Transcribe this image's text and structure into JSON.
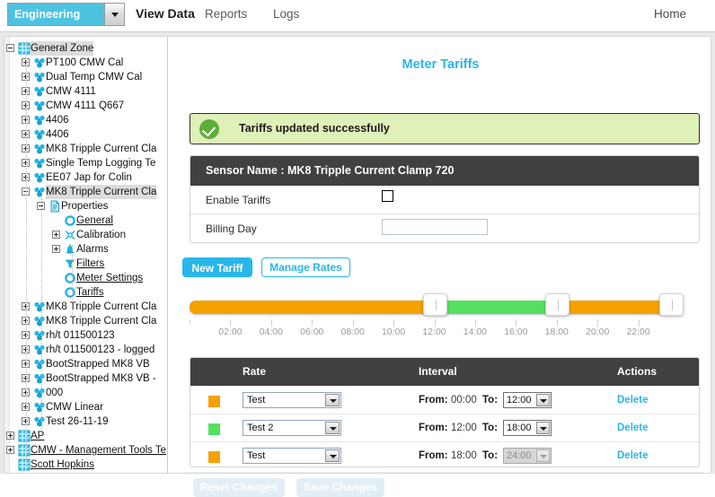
{
  "topnav": {
    "zone_selector": {
      "value": "Engineering",
      "icon": "chevron-down-icon"
    },
    "items": [
      {
        "label": "View Data",
        "active": true
      },
      {
        "label": "Reports",
        "active": false
      },
      {
        "label": "Logs",
        "active": false
      }
    ],
    "home_label": "Home"
  },
  "sidebar": {
    "nodes": [
      {
        "label": "General Zone",
        "depth": 0,
        "icon": "zone-grid-icon",
        "toggle": "minus",
        "selected": true,
        "link": false
      },
      {
        "label": "PT100 CMW Cal",
        "depth": 1,
        "icon": "sensor-icon",
        "toggle": "plus",
        "selected": false,
        "link": false
      },
      {
        "label": "Dual Temp CMW Cal",
        "depth": 1,
        "icon": "sensor-icon",
        "toggle": "plus",
        "selected": false,
        "link": false
      },
      {
        "label": "CMW 4111",
        "depth": 1,
        "icon": "sensor-icon",
        "toggle": "plus",
        "selected": false,
        "link": false
      },
      {
        "label": "CMW 4111 Q667",
        "depth": 1,
        "icon": "sensor-icon",
        "toggle": "plus",
        "selected": false,
        "link": false
      },
      {
        "label": "4406",
        "depth": 1,
        "icon": "sensor-icon",
        "toggle": "plus",
        "selected": false,
        "link": false
      },
      {
        "label": "4406",
        "depth": 1,
        "icon": "sensor-icon",
        "toggle": "plus",
        "selected": false,
        "link": false
      },
      {
        "label": "MK8 Tripple Current Cla",
        "depth": 1,
        "icon": "sensor-icon",
        "toggle": "plus",
        "selected": false,
        "link": false
      },
      {
        "label": "Single Temp Logging Te",
        "depth": 1,
        "icon": "sensor-icon",
        "toggle": "plus",
        "selected": false,
        "link": false
      },
      {
        "label": "EE07 Jap for Colin",
        "depth": 1,
        "icon": "sensor-icon",
        "toggle": "plus",
        "selected": false,
        "link": false
      },
      {
        "label": "MK8 Tripple Current Cla",
        "depth": 1,
        "icon": "sensor-icon",
        "toggle": "minus",
        "selected": true,
        "link": false
      },
      {
        "label": "Properties",
        "depth": 2,
        "icon": "document-icon",
        "toggle": "minus",
        "selected": false,
        "link": false
      },
      {
        "label": "General",
        "depth": 3,
        "icon": "circle-icon",
        "toggle": "none",
        "selected": false,
        "link": true
      },
      {
        "label": "Calibration",
        "depth": 3,
        "icon": "calibration-icon",
        "toggle": "plus",
        "selected": false,
        "link": false
      },
      {
        "label": "Alarms",
        "depth": 3,
        "icon": "bell-icon",
        "toggle": "plus",
        "selected": false,
        "link": false
      },
      {
        "label": "Filters",
        "depth": 3,
        "icon": "funnel-icon",
        "toggle": "none",
        "selected": false,
        "link": true
      },
      {
        "label": "Meter Settings",
        "depth": 3,
        "icon": "circle-icon",
        "toggle": "none",
        "selected": false,
        "link": true
      },
      {
        "label": "Tariffs",
        "depth": 3,
        "icon": "circle-icon",
        "toggle": "none",
        "selected": false,
        "link": true
      },
      {
        "label": "MK8 Tripple Current Cla",
        "depth": 1,
        "icon": "sensor-icon",
        "toggle": "plus",
        "selected": false,
        "link": false
      },
      {
        "label": "MK8 Tripple Current Cla",
        "depth": 1,
        "icon": "sensor-icon",
        "toggle": "plus",
        "selected": false,
        "link": false
      },
      {
        "label": "rh/t 011500123",
        "depth": 1,
        "icon": "sensor-icon",
        "toggle": "plus",
        "selected": false,
        "link": false
      },
      {
        "label": "rh/t 011500123 - logged",
        "depth": 1,
        "icon": "sensor-icon",
        "toggle": "plus",
        "selected": false,
        "link": false
      },
      {
        "label": "BootStrapped MK8 VB",
        "depth": 1,
        "icon": "sensor-icon",
        "toggle": "plus",
        "selected": false,
        "link": false
      },
      {
        "label": "BootStrapped MK8 VB -",
        "depth": 1,
        "icon": "sensor-icon",
        "toggle": "plus",
        "selected": false,
        "link": false
      },
      {
        "label": "000",
        "depth": 1,
        "icon": "sensor-icon",
        "toggle": "plus",
        "selected": false,
        "link": false
      },
      {
        "label": "CMW Linear",
        "depth": 1,
        "icon": "sensor-icon",
        "toggle": "plus",
        "selected": false,
        "link": false
      },
      {
        "label": "Test 26-11-19",
        "depth": 1,
        "icon": "sensor-icon",
        "toggle": "plus",
        "selected": false,
        "link": false
      },
      {
        "label": "AP",
        "depth": 0,
        "icon": "zone-grid-icon",
        "toggle": "plus",
        "selected": false,
        "link": true
      },
      {
        "label": "CMW - Management Tools Te",
        "depth": 0,
        "icon": "zone-grid-icon",
        "toggle": "plus",
        "selected": false,
        "link": true
      },
      {
        "label": "Scott Hopkins",
        "depth": 0,
        "icon": "zone-grid-icon",
        "toggle": "none",
        "selected": false,
        "link": true
      }
    ]
  },
  "main": {
    "page_title": "Meter Tariffs",
    "alert": {
      "icon": "check-circle-icon",
      "text": "Tariffs updated successfully"
    },
    "card": {
      "header": "Sensor Name : MK8 Tripple Current Clamp 720",
      "enable_tariffs_label": "Enable Tariffs",
      "enable_tariffs_checked": false,
      "billing_day_label": "Billing Day",
      "billing_day_value": "",
      "billing_day_placeholder": ""
    },
    "actions": {
      "new_tariff": "New Tariff",
      "manage_rates": "Manage Rates"
    },
    "timeline": {
      "segments": [
        {
          "color": "#f5a200",
          "start_pct": 0,
          "end_pct": 50
        },
        {
          "color": "#55e060",
          "start_pct": 50,
          "end_pct": 75
        },
        {
          "color": "#f5a200",
          "start_pct": 75,
          "end_pct": 100
        }
      ],
      "handles_pct": [
        50,
        75,
        100
      ],
      "tick_labels": [
        "02:00",
        "04:00",
        "06:00",
        "08:00",
        "10:00",
        "12:00",
        "14:00",
        "16:00",
        "18:00",
        "20:00",
        "22:00"
      ],
      "axis_min": "00:00",
      "axis_max": "24:00"
    },
    "table": {
      "columns": [
        "Rate",
        "Interval",
        "Actions"
      ],
      "from_label": "From:",
      "to_label": "To:",
      "rows": [
        {
          "color": "#f5a200",
          "rate": "Test",
          "from": "00:00",
          "to": "12:00",
          "to_disabled": false,
          "action": "Delete"
        },
        {
          "color": "#55e060",
          "rate": "Test 2",
          "from": "12:00",
          "to": "18:00",
          "to_disabled": false,
          "action": "Delete"
        },
        {
          "color": "#f5a200",
          "rate": "Test",
          "from": "18:00",
          "to": "24:00",
          "to_disabled": true,
          "action": "Delete"
        }
      ]
    },
    "footer": {
      "reset_label": "Reset Changes",
      "save_label": "Save Changes",
      "disabled": true
    }
  }
}
